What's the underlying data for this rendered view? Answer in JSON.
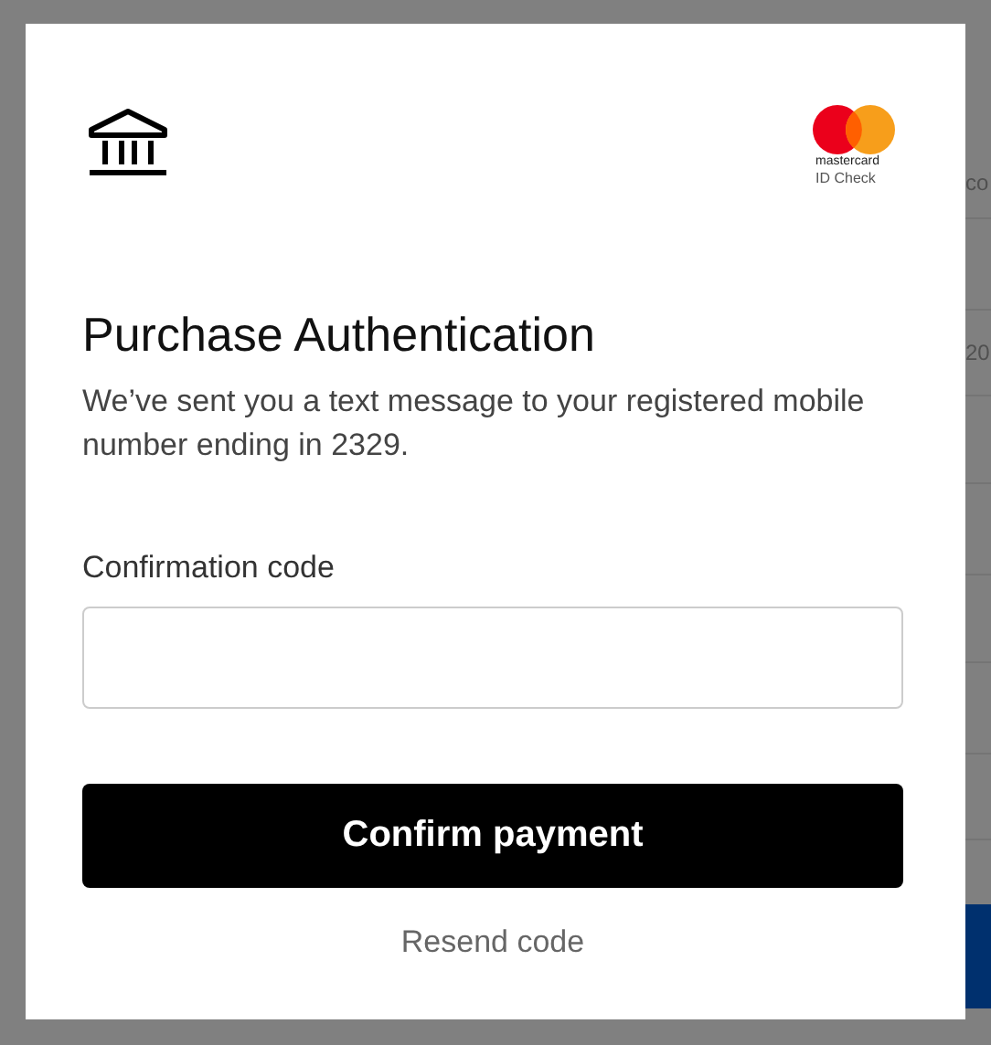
{
  "background_page": {
    "row_fragments": [
      "co",
      "20"
    ]
  },
  "dialog": {
    "brand": {
      "name": "mastercard",
      "product": "ID Check"
    },
    "title": "Purchase Authentication",
    "message": "We’ve sent you a text message to your registered mobile number ending in 2329.",
    "code_field": {
      "label": "Confirmation code"
    },
    "confirm_button": "Confirm payment",
    "resend_link": "Resend code"
  }
}
